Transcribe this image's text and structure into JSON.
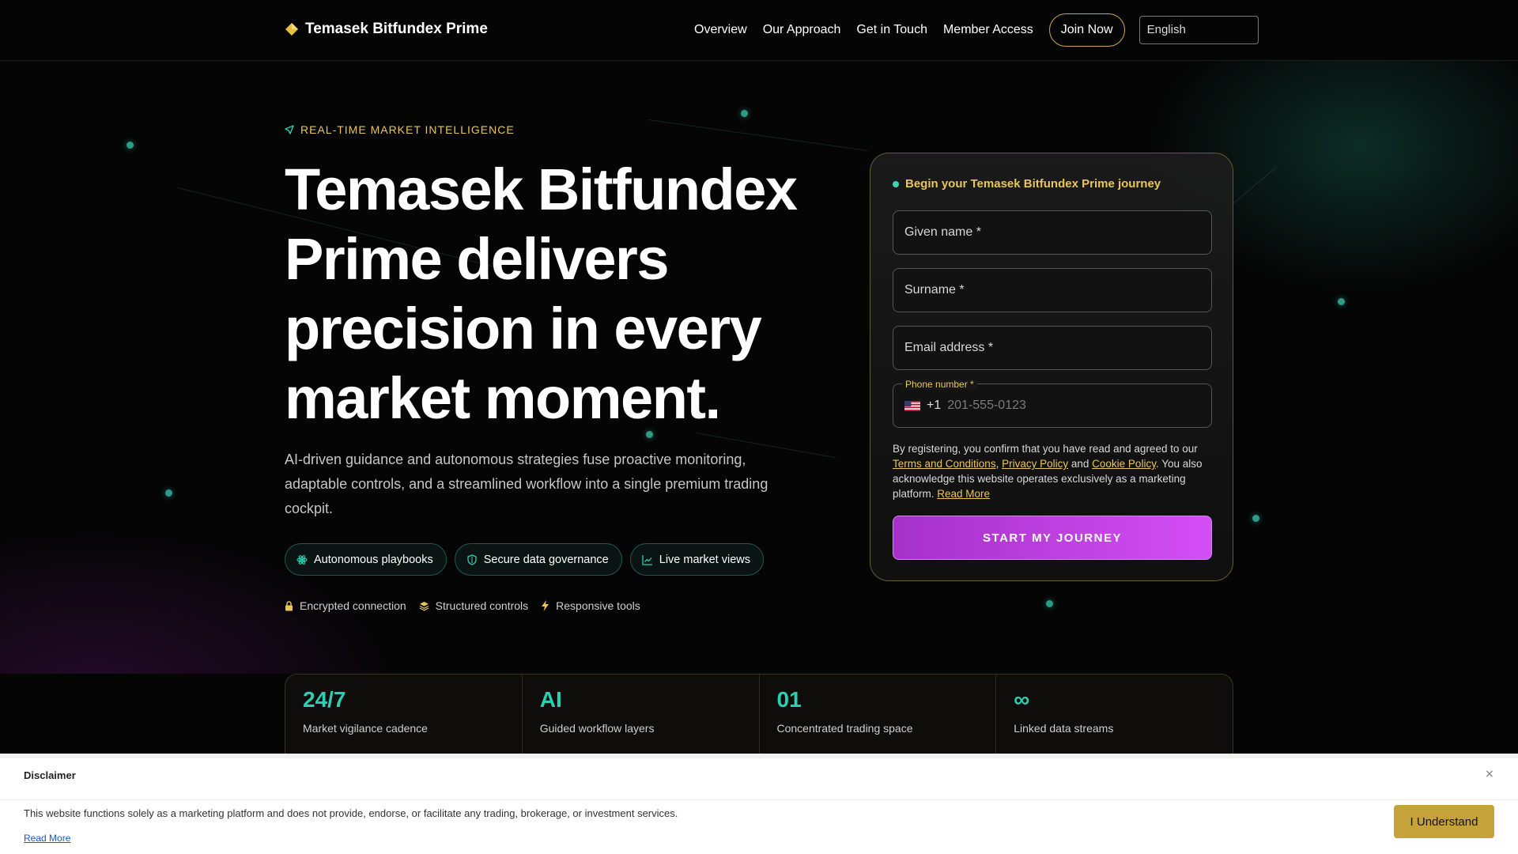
{
  "header": {
    "brand": "Temasek Bitfundex Prime",
    "nav": [
      "Overview",
      "Our Approach",
      "Get in Touch",
      "Member Access"
    ],
    "join_label": "Join Now",
    "language": "English"
  },
  "hero": {
    "eyebrow": "REAL-TIME MARKET INTELLIGENCE",
    "title": "Temasek Bitfundex Prime delivers precision in every market moment.",
    "lede": "AI-driven guidance and autonomous strategies fuse proactive monitoring, adaptable controls, and a streamlined workflow into a single premium trading cockpit.",
    "chips": [
      {
        "label": "Autonomous playbooks",
        "icon": "atom-icon"
      },
      {
        "label": "Secure data governance",
        "icon": "shield-icon"
      },
      {
        "label": "Live market views",
        "icon": "chart-icon"
      }
    ],
    "trust": [
      {
        "label": "Encrypted connection",
        "icon": "lock-icon"
      },
      {
        "label": "Structured controls",
        "icon": "layers-icon"
      },
      {
        "label": "Responsive tools",
        "icon": "bolt-icon"
      }
    ]
  },
  "form": {
    "title": "Begin your Temasek Bitfundex Prime journey",
    "given_name_placeholder": "Given name *",
    "surname_placeholder": "Surname *",
    "email_placeholder": "Email address *",
    "phone_label": "Phone number *",
    "phone_code": "+1",
    "phone_placeholder": "201-555-0123",
    "legal_1": "By registering, you confirm that you have read and agreed to our ",
    "terms": "Terms and Conditions",
    "comma": ", ",
    "privacy": "Privacy Policy",
    "and": " and ",
    "cookie": "Cookie Policy",
    "legal_2": ". You also acknowledge this website operates exclusively as a marketing platform. ",
    "read_more": "Read More",
    "cta": "START MY JOURNEY"
  },
  "stats": [
    {
      "value": "24/7",
      "label": "Market vigilance cadence"
    },
    {
      "value": "AI",
      "label": "Guided workflow layers"
    },
    {
      "value": "01",
      "label": "Concentrated trading space"
    },
    {
      "value": "∞",
      "label": "Linked data streams"
    }
  ],
  "disclaimer": {
    "title": "Disclaimer",
    "close": "×",
    "text": "This website functions solely as a marketing platform and does not provide, endorse, or facilitate any trading, brokerage, or investment services.",
    "read_more": "Read More",
    "button": "I Understand"
  },
  "colors": {
    "accent_gold": "#e8c659",
    "accent_teal": "#2bd0b3",
    "cta_purple": "#c03ee0"
  }
}
